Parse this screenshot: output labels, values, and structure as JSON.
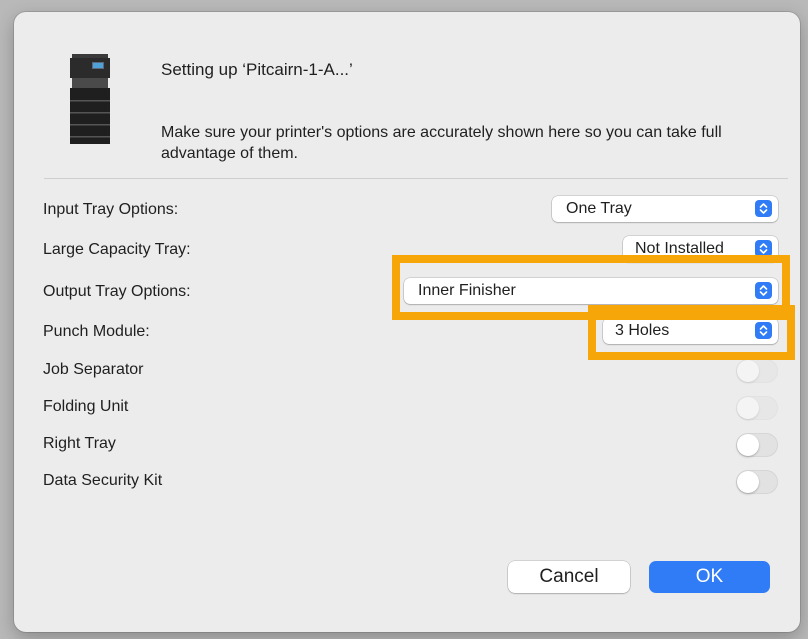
{
  "dialog": {
    "title": "Setting up ‘Pitcairn-1-A...’",
    "description": "Make sure your printer's options are accurately shown here so you can take full advantage of them."
  },
  "options": {
    "input_tray": {
      "label": "Input Tray Options:",
      "value": "One Tray"
    },
    "large_capacity_tray": {
      "label": "Large Capacity Tray:",
      "value": "Not Installed"
    },
    "output_tray": {
      "label": "Output Tray Options:",
      "value": "Inner Finisher"
    },
    "punch_module": {
      "label": "Punch Module:",
      "value": "3 Holes"
    },
    "job_separator": {
      "label": "Job Separator",
      "on": false,
      "enabled": false
    },
    "folding_unit": {
      "label": "Folding Unit",
      "on": false,
      "enabled": false
    },
    "right_tray": {
      "label": "Right Tray",
      "on": false,
      "enabled": true
    },
    "data_security_kit": {
      "label": "Data Security Kit",
      "on": false,
      "enabled": true
    }
  },
  "buttons": {
    "cancel": "Cancel",
    "ok": "OK"
  },
  "colors": {
    "accent": "#2f7cf6",
    "highlight": "#f6a609",
    "dialog_bg": "#ececec"
  },
  "icons": {
    "printer": "printer-icon",
    "popup_arrows": "chevron-up-down-icon"
  }
}
